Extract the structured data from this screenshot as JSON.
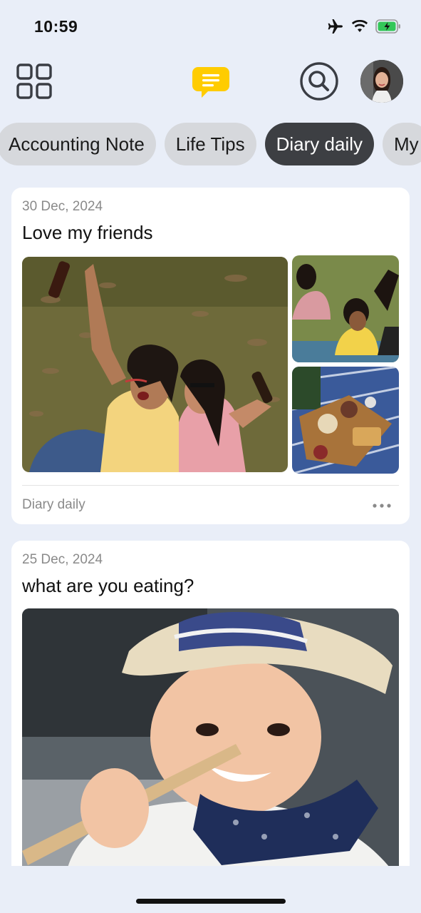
{
  "status_bar": {
    "time": "10:59",
    "icons": [
      "airplane-icon",
      "wifi-icon",
      "battery-charging-icon"
    ],
    "battery_color": "#34c759"
  },
  "top_nav": {
    "left_icon": "grid-icon",
    "center_icon": "notes-chat-icon",
    "center_icon_color": "#ffcc00",
    "search_icon": "search-icon",
    "avatar": "profile-avatar"
  },
  "tabs": [
    {
      "label": "Accounting Note",
      "active": false
    },
    {
      "label": "Life Tips",
      "active": false
    },
    {
      "label": "Diary daily",
      "active": true
    },
    {
      "label": "My",
      "active": false
    }
  ],
  "posts": [
    {
      "date": "30 Dec, 2024",
      "title": "Love my friends",
      "folder": "Diary daily",
      "photos": [
        "friends-grass-photo",
        "friends-picnic-photo",
        "picnic-food-photo"
      ]
    },
    {
      "date": "25 Dec, 2024",
      "title": "what are you eating?",
      "photos": [
        "child-eating-photo"
      ]
    }
  ]
}
